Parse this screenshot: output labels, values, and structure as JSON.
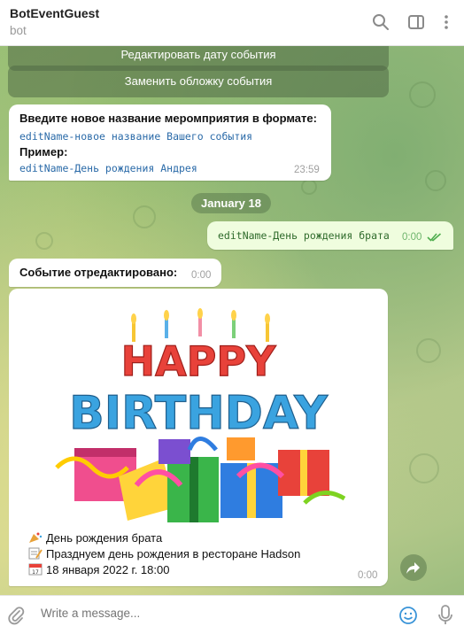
{
  "header": {
    "title": "BotEventGuest",
    "subtitle": "bot"
  },
  "keyboard_buttons": [
    {
      "label": "Редактировать дату события"
    },
    {
      "label": "Заменить обложку события"
    }
  ],
  "messages": {
    "prompt": {
      "line1": "Введите новое название меромприятия в формате:",
      "line2": "editName-новое название Вашего события",
      "line3": "Пример:",
      "line4": "editName-День рождения Андрея",
      "time": "23:59"
    },
    "date_divider": "January 18",
    "outgoing": {
      "text": "editName-День рождения брата",
      "time": "0:00"
    },
    "edited": {
      "text": "Событие отредактировано:",
      "time": "0:00"
    },
    "card": {
      "image_text_line1": "HAPPY",
      "image_text_line2": "BIRTHDAY",
      "line1": "День рождения брата",
      "line2": "Празднуем день рождения в ресторане Hadson",
      "line3": "18 января 2022 г. 18:00",
      "time": "0:00",
      "icons": [
        "party-popper-icon",
        "memo-icon",
        "calendar-icon"
      ]
    }
  },
  "composer": {
    "placeholder": "Write a message..."
  },
  "colors": {
    "header_bg": "#ffffff",
    "outgoing_bubble": "#effdde",
    "check_color": "#4fae4e",
    "link_mono": "#2a6aa8"
  }
}
